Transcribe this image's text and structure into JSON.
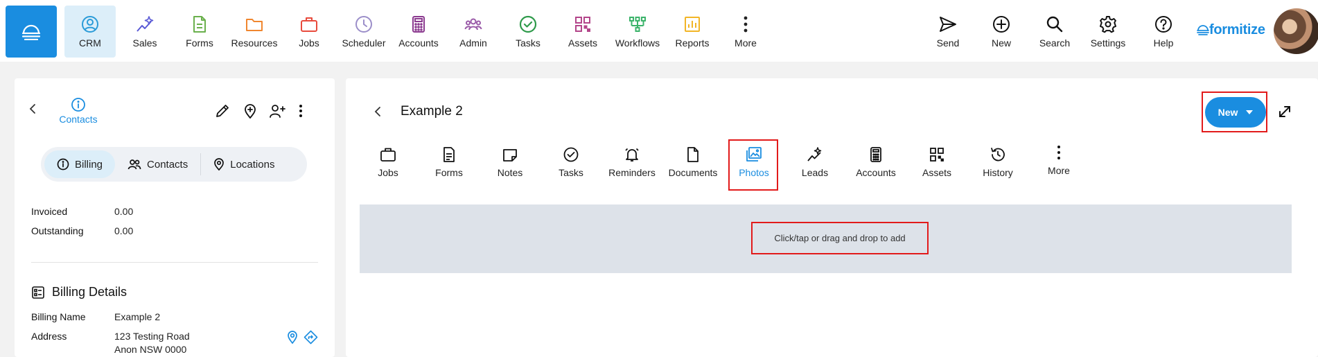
{
  "nav": {
    "items": [
      {
        "id": "crm",
        "label": "CRM",
        "icon": "person-circle-icon",
        "active": true
      },
      {
        "id": "sales",
        "label": "Sales",
        "icon": "sparkle-chart-icon"
      },
      {
        "id": "forms",
        "label": "Forms",
        "icon": "document-icon"
      },
      {
        "id": "resources",
        "label": "Resources",
        "icon": "folder-icon"
      },
      {
        "id": "jobs",
        "label": "Jobs",
        "icon": "briefcase-icon"
      },
      {
        "id": "scheduler",
        "label": "Scheduler",
        "icon": "clock-icon"
      },
      {
        "id": "accounts",
        "label": "Accounts",
        "icon": "calculator-icon"
      },
      {
        "id": "admin",
        "label": "Admin",
        "icon": "people-group-icon"
      },
      {
        "id": "tasks",
        "label": "Tasks",
        "icon": "check-circle-icon"
      },
      {
        "id": "assets",
        "label": "Assets",
        "icon": "qr-code-icon"
      },
      {
        "id": "workflows",
        "label": "Workflows",
        "icon": "workflow-icon"
      },
      {
        "id": "reports",
        "label": "Reports",
        "icon": "bar-chart-icon"
      },
      {
        "id": "more",
        "label": "More",
        "icon": "more-vertical-icon"
      }
    ],
    "right_items": [
      {
        "id": "send",
        "label": "Send",
        "icon": "send-icon"
      },
      {
        "id": "new",
        "label": "New",
        "icon": "plus-circle-icon"
      },
      {
        "id": "search",
        "label": "Search",
        "icon": "search-icon"
      },
      {
        "id": "settings",
        "label": "Settings",
        "icon": "gear-icon"
      },
      {
        "id": "help",
        "label": "Help",
        "icon": "help-circle-icon"
      }
    ],
    "brand": "formitize"
  },
  "left_panel": {
    "contacts_label": "Contacts",
    "segments": [
      {
        "label": "Billing",
        "icon": "info-icon",
        "active": true
      },
      {
        "label": "Contacts",
        "icon": "people-icon"
      },
      {
        "label": "Locations",
        "icon": "map-pin-icon"
      }
    ],
    "summary": [
      {
        "label": "Invoiced",
        "value": "0.00"
      },
      {
        "label": "Outstanding",
        "value": "0.00"
      }
    ],
    "billing_details_title": "Billing Details",
    "billing_name_label": "Billing Name",
    "billing_name_value": "Example 2",
    "address_label": "Address",
    "address_line1": "123 Testing Road",
    "address_line2": "Anon NSW 0000"
  },
  "right_panel": {
    "title": "Example 2",
    "new_button_label": "New",
    "tabs": [
      {
        "label": "Jobs",
        "icon": "briefcase-icon"
      },
      {
        "label": "Forms",
        "icon": "document-icon"
      },
      {
        "label": "Notes",
        "icon": "note-icon"
      },
      {
        "label": "Tasks",
        "icon": "check-circle-icon"
      },
      {
        "label": "Reminders",
        "icon": "bell-icon"
      },
      {
        "label": "Documents",
        "icon": "file-icon"
      },
      {
        "label": "Photos",
        "icon": "photo-icon",
        "active": true
      },
      {
        "label": "Leads",
        "icon": "sparkle-chart-icon"
      },
      {
        "label": "Accounts",
        "icon": "calculator-icon"
      },
      {
        "label": "Assets",
        "icon": "qr-code-icon"
      },
      {
        "label": "History",
        "icon": "history-icon"
      },
      {
        "label": "More",
        "icon": "more-vertical-icon"
      }
    ],
    "dropzone_text": "Click/tap or drag and drop to add"
  },
  "colors": {
    "accent": "#1a8de0",
    "highlight": "#e21a1a",
    "crm_active_bg": "#dceef9"
  }
}
